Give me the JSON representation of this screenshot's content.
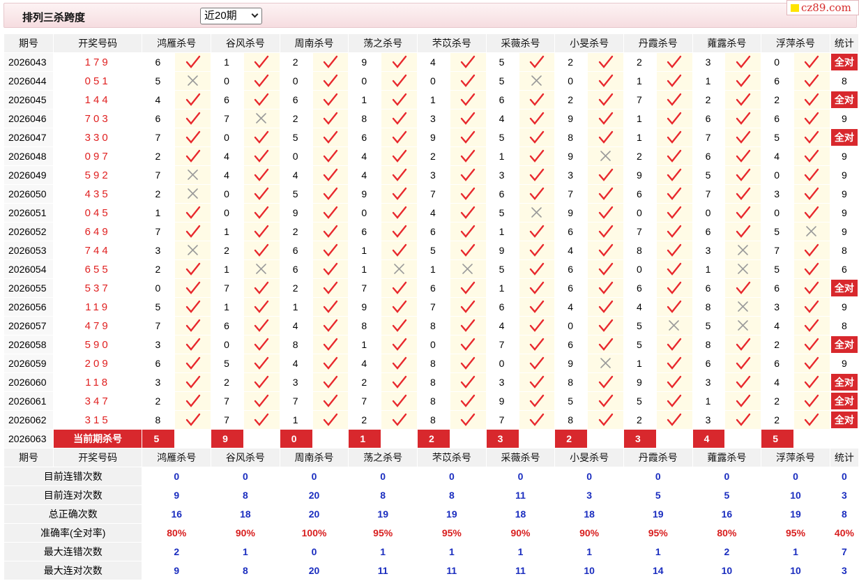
{
  "header": {
    "title": "排列三杀跨度",
    "period_select": "近20期",
    "logo_text": "cz89.com"
  },
  "columns": {
    "period": "期号",
    "drawn": "开奖号码",
    "experts": [
      "鸿雁杀号",
      "谷风杀号",
      "周南杀号",
      "荡之杀号",
      "芣苡杀号",
      "采薇杀号",
      "小旻杀号",
      "丹霞杀号",
      "蕹露杀号",
      "浮萍杀号"
    ],
    "stat": "统计"
  },
  "rows": [
    {
      "period": "2026043",
      "drawn": "179",
      "kills": [
        [
          6,
          1
        ],
        [
          1,
          1
        ],
        [
          2,
          1
        ],
        [
          9,
          1
        ],
        [
          4,
          1
        ],
        [
          5,
          1
        ],
        [
          2,
          1
        ],
        [
          2,
          1
        ],
        [
          3,
          1
        ],
        [
          0,
          1
        ]
      ],
      "stat": "全对"
    },
    {
      "period": "2026044",
      "drawn": "051",
      "kills": [
        [
          5,
          0
        ],
        [
          0,
          1
        ],
        [
          0,
          1
        ],
        [
          0,
          1
        ],
        [
          0,
          1
        ],
        [
          5,
          0
        ],
        [
          0,
          1
        ],
        [
          1,
          1
        ],
        [
          1,
          1
        ],
        [
          6,
          1
        ]
      ],
      "stat": "8"
    },
    {
      "period": "2026045",
      "drawn": "144",
      "kills": [
        [
          4,
          1
        ],
        [
          6,
          1
        ],
        [
          6,
          1
        ],
        [
          1,
          1
        ],
        [
          1,
          1
        ],
        [
          6,
          1
        ],
        [
          2,
          1
        ],
        [
          7,
          1
        ],
        [
          2,
          1
        ],
        [
          2,
          1
        ]
      ],
      "stat": "全对"
    },
    {
      "period": "2026046",
      "drawn": "703",
      "kills": [
        [
          6,
          1
        ],
        [
          7,
          0
        ],
        [
          2,
          1
        ],
        [
          8,
          1
        ],
        [
          3,
          1
        ],
        [
          4,
          1
        ],
        [
          9,
          1
        ],
        [
          1,
          1
        ],
        [
          6,
          1
        ],
        [
          6,
          1
        ]
      ],
      "stat": "9"
    },
    {
      "period": "2026047",
      "drawn": "330",
      "kills": [
        [
          7,
          1
        ],
        [
          0,
          1
        ],
        [
          5,
          1
        ],
        [
          6,
          1
        ],
        [
          9,
          1
        ],
        [
          5,
          1
        ],
        [
          8,
          1
        ],
        [
          1,
          1
        ],
        [
          7,
          1
        ],
        [
          5,
          1
        ]
      ],
      "stat": "全对"
    },
    {
      "period": "2026048",
      "drawn": "097",
      "kills": [
        [
          2,
          1
        ],
        [
          4,
          1
        ],
        [
          0,
          1
        ],
        [
          4,
          1
        ],
        [
          2,
          1
        ],
        [
          1,
          1
        ],
        [
          9,
          0
        ],
        [
          2,
          1
        ],
        [
          6,
          1
        ],
        [
          4,
          1
        ]
      ],
      "stat": "9"
    },
    {
      "period": "2026049",
      "drawn": "592",
      "kills": [
        [
          7,
          0
        ],
        [
          4,
          1
        ],
        [
          4,
          1
        ],
        [
          4,
          1
        ],
        [
          3,
          1
        ],
        [
          3,
          1
        ],
        [
          3,
          1
        ],
        [
          9,
          1
        ],
        [
          5,
          1
        ],
        [
          0,
          1
        ]
      ],
      "stat": "9"
    },
    {
      "period": "2026050",
      "drawn": "435",
      "kills": [
        [
          2,
          0
        ],
        [
          0,
          1
        ],
        [
          5,
          1
        ],
        [
          9,
          1
        ],
        [
          7,
          1
        ],
        [
          6,
          1
        ],
        [
          7,
          1
        ],
        [
          6,
          1
        ],
        [
          7,
          1
        ],
        [
          3,
          1
        ]
      ],
      "stat": "9"
    },
    {
      "period": "2026051",
      "drawn": "045",
      "kills": [
        [
          1,
          1
        ],
        [
          0,
          1
        ],
        [
          9,
          1
        ],
        [
          0,
          1
        ],
        [
          4,
          1
        ],
        [
          5,
          0
        ],
        [
          9,
          1
        ],
        [
          0,
          1
        ],
        [
          0,
          1
        ],
        [
          0,
          1
        ]
      ],
      "stat": "9"
    },
    {
      "period": "2026052",
      "drawn": "649",
      "kills": [
        [
          7,
          1
        ],
        [
          1,
          1
        ],
        [
          2,
          1
        ],
        [
          6,
          1
        ],
        [
          6,
          1
        ],
        [
          1,
          1
        ],
        [
          6,
          1
        ],
        [
          7,
          1
        ],
        [
          6,
          1
        ],
        [
          5,
          0
        ]
      ],
      "stat": "9"
    },
    {
      "period": "2026053",
      "drawn": "744",
      "kills": [
        [
          3,
          0
        ],
        [
          2,
          1
        ],
        [
          6,
          1
        ],
        [
          1,
          1
        ],
        [
          5,
          1
        ],
        [
          9,
          1
        ],
        [
          4,
          1
        ],
        [
          8,
          1
        ],
        [
          3,
          0
        ],
        [
          7,
          1
        ]
      ],
      "stat": "8"
    },
    {
      "period": "2026054",
      "drawn": "655",
      "kills": [
        [
          2,
          1
        ],
        [
          1,
          0
        ],
        [
          6,
          1
        ],
        [
          1,
          0
        ],
        [
          1,
          0
        ],
        [
          5,
          1
        ],
        [
          6,
          1
        ],
        [
          0,
          1
        ],
        [
          1,
          0
        ],
        [
          5,
          1
        ]
      ],
      "stat": "6"
    },
    {
      "period": "2026055",
      "drawn": "537",
      "kills": [
        [
          0,
          1
        ],
        [
          7,
          1
        ],
        [
          2,
          1
        ],
        [
          7,
          1
        ],
        [
          6,
          1
        ],
        [
          1,
          1
        ],
        [
          6,
          1
        ],
        [
          6,
          1
        ],
        [
          6,
          1
        ],
        [
          6,
          1
        ]
      ],
      "stat": "全对"
    },
    {
      "period": "2026056",
      "drawn": "119",
      "kills": [
        [
          5,
          1
        ],
        [
          1,
          1
        ],
        [
          1,
          1
        ],
        [
          9,
          1
        ],
        [
          7,
          1
        ],
        [
          6,
          1
        ],
        [
          4,
          1
        ],
        [
          4,
          1
        ],
        [
          8,
          0
        ],
        [
          3,
          1
        ]
      ],
      "stat": "9"
    },
    {
      "period": "2026057",
      "drawn": "479",
      "kills": [
        [
          7,
          1
        ],
        [
          6,
          1
        ],
        [
          4,
          1
        ],
        [
          8,
          1
        ],
        [
          8,
          1
        ],
        [
          4,
          1
        ],
        [
          0,
          1
        ],
        [
          5,
          0
        ],
        [
          5,
          0
        ],
        [
          4,
          1
        ]
      ],
      "stat": "8"
    },
    {
      "period": "2026058",
      "drawn": "590",
      "kills": [
        [
          3,
          1
        ],
        [
          0,
          1
        ],
        [
          8,
          1
        ],
        [
          1,
          1
        ],
        [
          0,
          1
        ],
        [
          7,
          1
        ],
        [
          6,
          1
        ],
        [
          5,
          1
        ],
        [
          8,
          1
        ],
        [
          2,
          1
        ]
      ],
      "stat": "全对"
    },
    {
      "period": "2026059",
      "drawn": "209",
      "kills": [
        [
          6,
          1
        ],
        [
          5,
          1
        ],
        [
          4,
          1
        ],
        [
          4,
          1
        ],
        [
          8,
          1
        ],
        [
          0,
          1
        ],
        [
          9,
          0
        ],
        [
          1,
          1
        ],
        [
          6,
          1
        ],
        [
          6,
          1
        ]
      ],
      "stat": "9"
    },
    {
      "period": "2026060",
      "drawn": "118",
      "kills": [
        [
          3,
          1
        ],
        [
          2,
          1
        ],
        [
          3,
          1
        ],
        [
          2,
          1
        ],
        [
          8,
          1
        ],
        [
          3,
          1
        ],
        [
          8,
          1
        ],
        [
          9,
          1
        ],
        [
          3,
          1
        ],
        [
          4,
          1
        ]
      ],
      "stat": "全对"
    },
    {
      "period": "2026061",
      "drawn": "347",
      "kills": [
        [
          2,
          1
        ],
        [
          7,
          1
        ],
        [
          7,
          1
        ],
        [
          7,
          1
        ],
        [
          8,
          1
        ],
        [
          9,
          1
        ],
        [
          5,
          1
        ],
        [
          5,
          1
        ],
        [
          1,
          1
        ],
        [
          2,
          1
        ]
      ],
      "stat": "全对"
    },
    {
      "period": "2026062",
      "drawn": "315",
      "kills": [
        [
          8,
          1
        ],
        [
          7,
          1
        ],
        [
          1,
          1
        ],
        [
          2,
          1
        ],
        [
          8,
          1
        ],
        [
          7,
          1
        ],
        [
          8,
          1
        ],
        [
          2,
          1
        ],
        [
          3,
          1
        ],
        [
          2,
          1
        ]
      ],
      "stat": "全对"
    }
  ],
  "current": {
    "period": "2026063",
    "label": "当前期杀号",
    "kills": [
      5,
      9,
      0,
      1,
      2,
      3,
      2,
      3,
      4,
      5
    ]
  },
  "summary": [
    {
      "label": "目前连错次数",
      "values": [
        "0",
        "0",
        "0",
        "0",
        "0",
        "0",
        "0",
        "0",
        "0",
        "0"
      ],
      "stat": "0",
      "red": false
    },
    {
      "label": "目前连对次数",
      "values": [
        "9",
        "8",
        "20",
        "8",
        "8",
        "11",
        "3",
        "5",
        "5",
        "10"
      ],
      "stat": "3",
      "red": false
    },
    {
      "label": "总正确次数",
      "values": [
        "16",
        "18",
        "20",
        "19",
        "19",
        "18",
        "18",
        "19",
        "16",
        "19"
      ],
      "stat": "8",
      "red": false
    },
    {
      "label": "准确率(全对率)",
      "values": [
        "80%",
        "90%",
        "100%",
        "95%",
        "95%",
        "90%",
        "90%",
        "95%",
        "80%",
        "95%"
      ],
      "stat": "40%",
      "red": true
    },
    {
      "label": "最大连错次数",
      "values": [
        "2",
        "1",
        "0",
        "1",
        "1",
        "1",
        "1",
        "1",
        "2",
        "1"
      ],
      "stat": "7",
      "red": false
    },
    {
      "label": "最大连对次数",
      "values": [
        "9",
        "8",
        "20",
        "11",
        "11",
        "11",
        "10",
        "14",
        "10",
        "10"
      ],
      "stat": "3",
      "red": false
    }
  ],
  "icons": {
    "correct": "check-icon",
    "wrong": "cross-icon"
  },
  "colors": {
    "accent_red": "#d8282d",
    "check_red": "#e8282d",
    "cross_gray": "#9a9a9a",
    "summary_blue": "#1a2dbf",
    "mark_bg": "#fffbe6"
  }
}
